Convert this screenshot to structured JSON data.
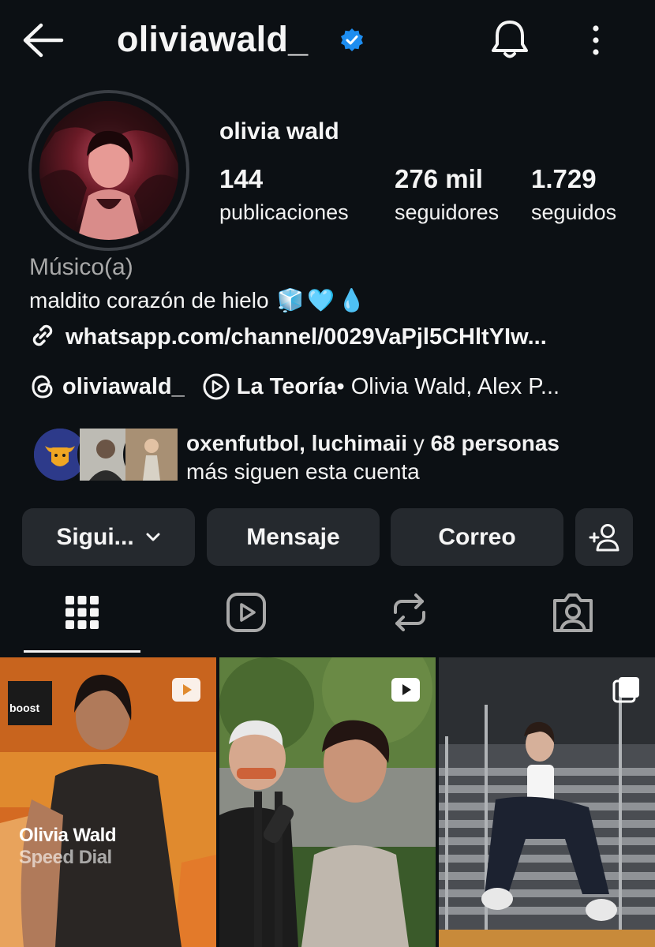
{
  "header": {
    "username": "oliviawald_",
    "icons": {
      "back": "arrow-left-icon",
      "verified": "verified-badge-icon",
      "bell": "bell-icon",
      "more": "more-vertical-icon"
    }
  },
  "profile": {
    "display_name": "olivia wald",
    "stats": [
      {
        "value": "144",
        "label": "publicaciones"
      },
      {
        "value": "276 mil",
        "label": "seguidores"
      },
      {
        "value": "1.729",
        "label": "seguidos"
      }
    ],
    "category": "Músico(a)",
    "bio": "maldito corazón de hielo",
    "bio_emoji": [
      "🧊",
      "🩵",
      "💧"
    ],
    "link": "whatsapp.com/channel/0029VaPjl5CHltYIw...",
    "threads_handle": "oliviawald_",
    "music_title": "La Teoría",
    "music_artists": " • Olivia Wald, Alex P..."
  },
  "followed_by": {
    "names": "oxenfutbol, luchimaii",
    "conjunction": " y ",
    "rest": "68 personas",
    "line2": "más siguen esta cuenta"
  },
  "actions": {
    "following": "Sigui...",
    "message": "Mensaje",
    "email": "Correo"
  },
  "tabs": [
    "grid-icon",
    "reels-icon",
    "reposts-icon",
    "tagged-icon"
  ],
  "grid": [
    {
      "overlay_title": "Olivia Wald",
      "overlay_subtitle": "Speed Dial",
      "brand": "boost"
    },
    {
      "overlay_title": "",
      "overlay_subtitle": ""
    },
    {
      "overlay_title": "",
      "overlay_subtitle": ""
    }
  ],
  "colors": {
    "background": "#0c1014",
    "button": "#25292e",
    "verified": "#1d8df0",
    "muted": "#a8a8a8"
  }
}
